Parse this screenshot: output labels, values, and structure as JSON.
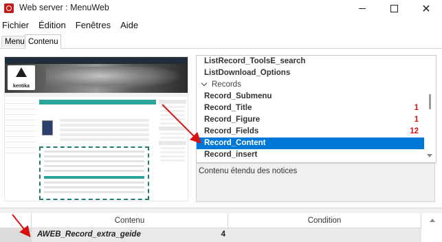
{
  "window": {
    "title": "Web server : MenuWeb",
    "controls": {
      "minimize_icon": "minimize-icon",
      "maximize_icon": "maximize-icon",
      "close_glyph": "✕"
    }
  },
  "menubar": {
    "items": [
      "Fichier",
      "Édition",
      "Fenêtres",
      "Aide"
    ]
  },
  "tabs": [
    "Menu",
    "Contenu"
  ],
  "active_tab": "Contenu",
  "preview": {
    "logo_text": "kentika"
  },
  "list": {
    "items": [
      {
        "label": "ListRecord_ToolsE_search",
        "count": ""
      },
      {
        "label": "ListDownload_Options",
        "count": ""
      },
      {
        "label": "Records",
        "count": "",
        "group": true
      },
      {
        "label": "Record_Submenu",
        "count": ""
      },
      {
        "label": "Record_Title",
        "count": "1"
      },
      {
        "label": "Record_Figure",
        "count": "1"
      },
      {
        "label": "Record_Fields",
        "count": "12"
      },
      {
        "label": "Record_Content",
        "count": "",
        "selected": true
      },
      {
        "label": "Record_insert",
        "count": ""
      }
    ],
    "count_color": "#e01010",
    "selection_color": "#0078d7"
  },
  "description": {
    "text": "Contenu étendu des notices"
  },
  "bottom_table": {
    "columns": [
      "Contenu",
      "Condition"
    ],
    "rows": [
      {
        "contenu": "AWEB_Record_extra_geide",
        "value": "4",
        "condition": ""
      }
    ]
  }
}
